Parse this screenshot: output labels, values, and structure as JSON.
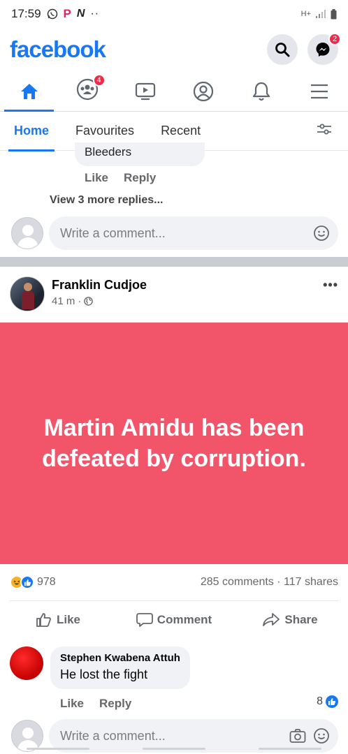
{
  "status_bar": {
    "time": "17:59",
    "p_icon": "P",
    "n_icon": "N",
    "dots": "··",
    "network": "H+"
  },
  "header": {
    "logo": "facebook",
    "messenger_badge": "2"
  },
  "nav": {
    "groups_badge": "4"
  },
  "tabs": [
    {
      "label": "Home"
    },
    {
      "label": "Favourites"
    },
    {
      "label": "Recent"
    }
  ],
  "prev_post": {
    "bubble_text": "Bleeders",
    "like_label": "Like",
    "reply_label": "Reply",
    "view_more": "View 3 more replies...",
    "write_placeholder": "Write a comment..."
  },
  "post": {
    "author": "Franklin Cudjoe",
    "time": "41 m",
    "time_sep": "·",
    "more": "•••",
    "text": "Martin Amidu has been defeated by corruption.",
    "bg_color": "#f2546a",
    "reactions_count": "978",
    "stats": "285 comments · 117 shares",
    "actions": {
      "like": "Like",
      "comment": "Comment",
      "share": "Share"
    }
  },
  "comment": {
    "author": "Stephen Kwabena Attuh",
    "text": "He lost the fight",
    "like_label": "Like",
    "reply_label": "Reply",
    "like_count": "8",
    "write_placeholder": "Write a comment..."
  },
  "colors": {
    "brand": "#1877f2",
    "badge": "#f02849"
  }
}
